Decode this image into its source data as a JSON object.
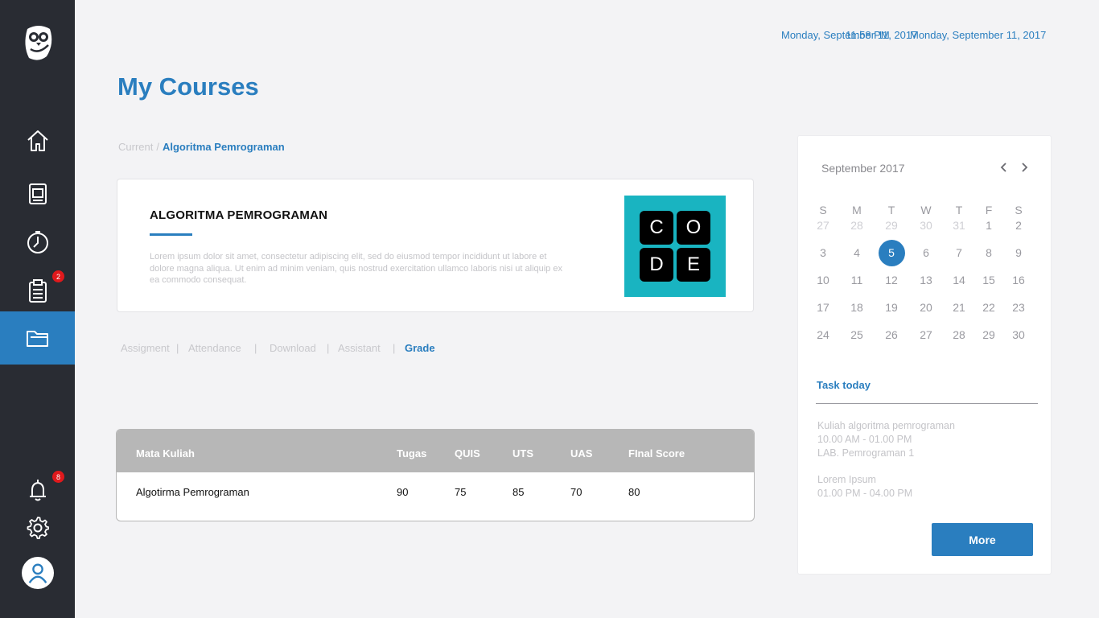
{
  "header": {
    "datetime_primary": "Monday, September 11, 2017",
    "time_overlap": "11:58 PM",
    "datetime_secondary": "Monday, September 11, 2017"
  },
  "page_title": "My Courses",
  "breadcrumb": {
    "parent": "Current",
    "separator": "/",
    "current": "Algoritma Pemrograman"
  },
  "sidebar": {
    "items": [
      {
        "name": "home",
        "icon": "home-icon"
      },
      {
        "name": "courses",
        "icon": "book-icon"
      },
      {
        "name": "schedule",
        "icon": "clock-icon"
      },
      {
        "name": "tasks",
        "icon": "clipboard-icon",
        "badge": "2"
      },
      {
        "name": "my-courses",
        "icon": "folder-icon",
        "active": true
      }
    ],
    "notifications_badge": "8",
    "bottom": [
      {
        "name": "notifications",
        "icon": "bell-icon"
      },
      {
        "name": "settings",
        "icon": "gear-icon"
      },
      {
        "name": "profile",
        "icon": "user-icon"
      }
    ]
  },
  "course": {
    "title": "ALGORITMA PEMROGRAMAN",
    "description": "Lorem ipsum dolor sit amet, consectetur adipiscing elit, sed do eiusmod tempor incididunt ut labore et dolore magna aliqua. Ut enim ad minim veniam, quis nostrud exercitation ullamco laboris nisi ut aliquip ex ea commodo consequat.",
    "logo_letters": [
      "C",
      "O",
      "D",
      "E"
    ],
    "logo_color": "#19b4c1"
  },
  "tabs": [
    "Assigment",
    "Attendance",
    "Download",
    "Assistant",
    "Grade"
  ],
  "tab_separator": "|",
  "active_tab": "Grade",
  "grade_table": {
    "headers": [
      "Mata Kuliah",
      "Tugas",
      "QUIS",
      "UTS",
      "UAS",
      "FInal Score"
    ],
    "rows": [
      [
        "Algotirma Pemrograman",
        "90",
        "75",
        "85",
        "70",
        "80"
      ]
    ]
  },
  "calendar": {
    "month_label": "September 2017",
    "weekdays": [
      "S",
      "M",
      "T",
      "W",
      "T",
      "F",
      "S"
    ],
    "weeks": [
      [
        "27",
        "28",
        "29",
        "30",
        "31",
        "1",
        "2"
      ],
      [
        "3",
        "4",
        "5",
        "6",
        "7",
        "8",
        "9"
      ],
      [
        "10",
        "11",
        "12",
        "13",
        "14",
        "15",
        "16"
      ],
      [
        "17",
        "18",
        "19",
        "20",
        "21",
        "22",
        "23"
      ],
      [
        "24",
        "25",
        "26",
        "27",
        "28",
        "29",
        "30"
      ]
    ],
    "selected_day": "5"
  },
  "tasks": {
    "title": "Task today",
    "items": [
      {
        "name": "Kuliah algoritma pemrograman",
        "time": "10.00 AM - 01.00 PM",
        "location": "LAB. Pemrograman 1"
      },
      {
        "name": "Lorem Ipsum",
        "time": "01.00 PM - 04.00 PM"
      }
    ],
    "more_label": "More"
  },
  "colors": {
    "accent": "#2a7ebf",
    "sidebar": "#292c33",
    "badge": "#e0191c",
    "table_header": "#b7b7b7"
  }
}
